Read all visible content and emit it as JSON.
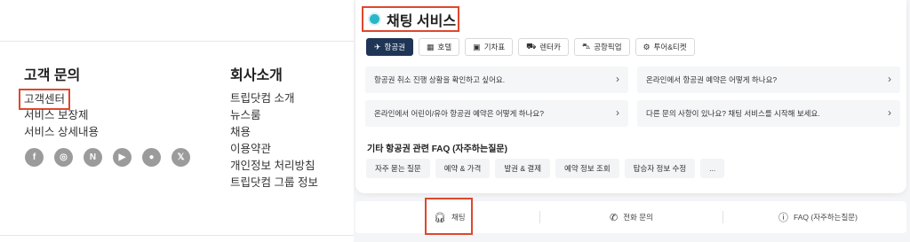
{
  "footer": {
    "customer": {
      "heading": "고객 문의",
      "links": [
        "고객센터",
        "서비스 보장제",
        "서비스 상세내용"
      ]
    },
    "company": {
      "heading": "회사소개",
      "links": [
        "트립닷컴 소개",
        "뉴스룸",
        "채용",
        "이용약관",
        "개인정보 처리방침",
        "트립닷컴 그룹 정보"
      ]
    },
    "social": [
      {
        "icon": "facebook-icon",
        "glyph": "f"
      },
      {
        "icon": "instagram-icon",
        "glyph": "◎"
      },
      {
        "icon": "naver-icon",
        "glyph": "N"
      },
      {
        "icon": "youtube-icon",
        "glyph": "▶"
      },
      {
        "icon": "kakao-icon",
        "glyph": "●"
      },
      {
        "icon": "x-icon",
        "glyph": "𝕏"
      }
    ]
  },
  "chat": {
    "title": "채팅 서비스",
    "tabs": [
      {
        "label": "항공권",
        "icon": "plane-icon",
        "glyph": "✈",
        "active": true
      },
      {
        "label": "호텔",
        "icon": "hotel-icon",
        "glyph": "▦",
        "active": false
      },
      {
        "label": "기차표",
        "icon": "train-icon",
        "glyph": "▣",
        "active": false
      },
      {
        "label": "렌터카",
        "icon": "car-icon",
        "glyph": "⛟",
        "active": false
      },
      {
        "label": "공항픽업",
        "icon": "pickup-icon",
        "glyph": "⛍",
        "active": false
      },
      {
        "label": "투어&티켓",
        "icon": "ticket-icon",
        "glyph": "⚙",
        "active": false
      }
    ],
    "faqs": [
      "항공권 취소 진행 상황을 확인하고 싶어요.",
      "온라인에서 항공권 예약은 어떻게 하나요?",
      "온라인에서 어린이/유아 항공권 예약은 어떻게 하나요?",
      "다른 문의 사항이 있나요? 채팅 서비스를 시작해 보세요."
    ],
    "faq_heading": "기타 항공권 관련 FAQ (자주하는질문)",
    "chips": [
      "자주 묻는 질문",
      "예약 & 가격",
      "발권 & 결제",
      "예약 정보 조회",
      "탑승자 정보 수정",
      "..."
    ],
    "bottom": {
      "chat": "채팅",
      "phone": "전화 문의",
      "faq": "FAQ (자주하는질문)"
    },
    "accent": "#1f3556",
    "highlight": "#e0472d"
  }
}
